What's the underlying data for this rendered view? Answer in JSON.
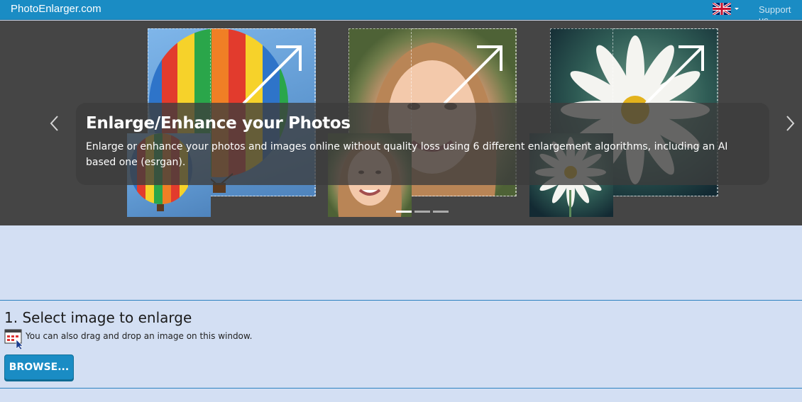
{
  "navbar": {
    "brand": "PhotoEnlarger.com",
    "language": "flag-uk-icon",
    "support": "Support us"
  },
  "carousel": {
    "slides": [
      {
        "title": "Enlarge/Enhance your Photos",
        "description": "Enlarge or enhance your photos and images online without quality loss using 6 different enlargement algorithms, including an AI based one (esrgan)."
      }
    ],
    "active_slide": 1,
    "slide_count": 3,
    "prev_icon": "chevron-left-icon",
    "next_icon": "chevron-right-icon"
  },
  "section": {
    "title": "1. Select image to enlarge",
    "drag_drop_hint": "You can also drag and drop an image on this window.",
    "drag_drop_icon": "drag-drop-window-icon",
    "browse_label": "BROWSE..."
  },
  "colors": {
    "accent": "#1a8cc4",
    "page_background": "#d3dff3",
    "carousel_background": "#454545"
  }
}
